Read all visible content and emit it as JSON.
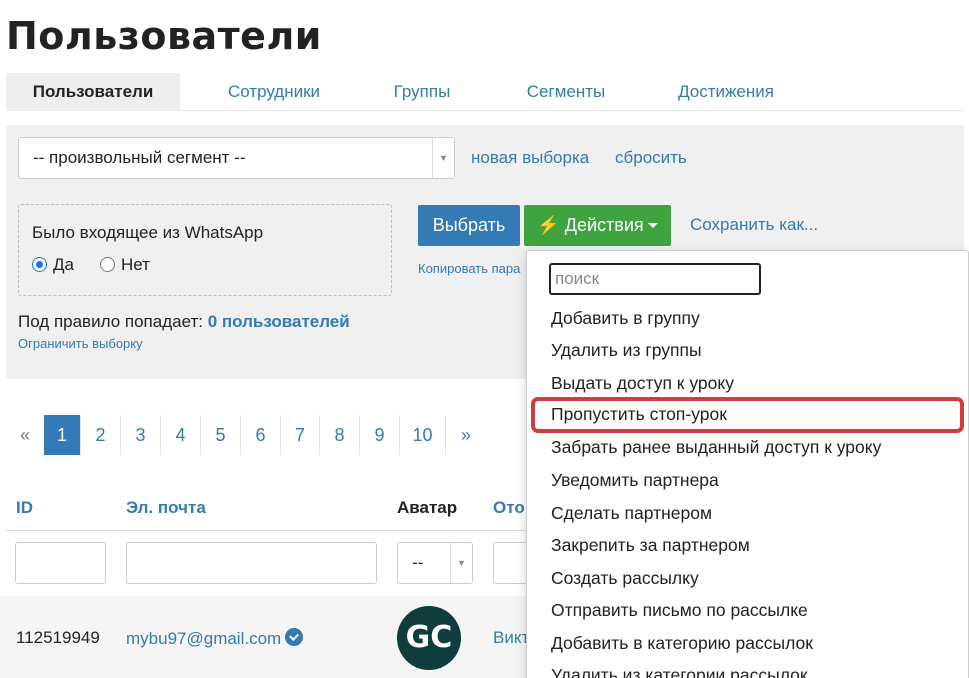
{
  "page": {
    "title": "Пользователи"
  },
  "tabs": [
    {
      "label": "Пользователи",
      "active": true
    },
    {
      "label": "Сотрудники"
    },
    {
      "label": "Группы"
    },
    {
      "label": "Сегменты"
    },
    {
      "label": "Достижения"
    }
  ],
  "filters": {
    "segment_select": "-- произвольный сегмент --",
    "new_selection": "новая выборка",
    "reset": "сбросить",
    "rule_label": "Было входящее из WhatsApp",
    "yes_label": "Да",
    "no_label": "Нет",
    "select_button": "Выбрать",
    "actions_button": "Действия",
    "save_as": "Сохранить как...",
    "copy_link": "Копировать пара",
    "rule_count_prefix": "Под правило попадает:",
    "rule_count_value": "0 пользователей",
    "limit_link": "Ограничить выборку"
  },
  "pagination": {
    "prev": "«",
    "pages": [
      "1",
      "2",
      "3",
      "4",
      "5",
      "6",
      "7",
      "8",
      "9",
      "10"
    ],
    "next": "»",
    "current": "1"
  },
  "table": {
    "headers": {
      "id": "ID",
      "email": "Эл. почта",
      "avatar": "Аватар",
      "from": "Ото"
    },
    "avatar_filter": "--",
    "rows": [
      {
        "id": "112519949",
        "email": "mybu97@gmail.com",
        "avatar_text": "GC",
        "from": "Викт"
      }
    ]
  },
  "actions_menu": {
    "search_placeholder": "поиск",
    "items": [
      "Добавить в группу",
      "Удалить из группы",
      "Выдать доступ к уроку",
      "Пропустить стоп-урок",
      "Забрать ранее выданный доступ к уроку",
      "Уведомить партнера",
      "Сделать партнером",
      "Закрепить за партнером",
      "Создать рассылку",
      "Отправить письмо по рассылке",
      "Добавить в категорию рассылок",
      "Удалить из категории рассылок"
    ],
    "highlighted_index": 3
  },
  "colors": {
    "accent": "#337ab7",
    "green": "#3fa33f",
    "highlight": "#d33c3c"
  }
}
